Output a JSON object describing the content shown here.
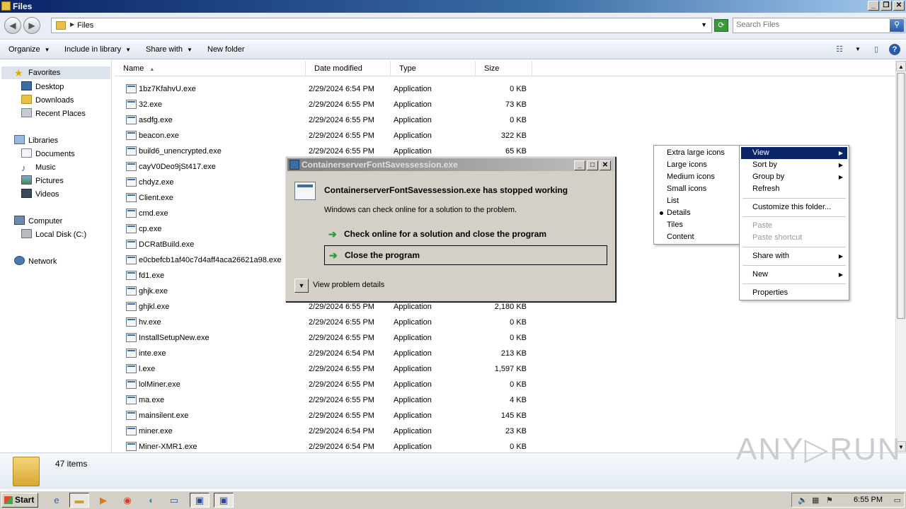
{
  "window": {
    "title": "Files",
    "controls": [
      "_",
      "❐",
      "✕"
    ]
  },
  "address": {
    "path": "Files",
    "search_placeholder": "Search Files"
  },
  "toolbar": {
    "organize": "Organize",
    "include_in_library": "Include in library",
    "share_with": "Share with",
    "new_folder": "New folder"
  },
  "nav": {
    "favorites": "Favorites",
    "desktop": "Desktop",
    "downloads": "Downloads",
    "recent_places": "Recent Places",
    "libraries": "Libraries",
    "documents": "Documents",
    "music": "Music",
    "pictures": "Pictures",
    "videos": "Videos",
    "computer": "Computer",
    "local_disk": "Local Disk (C:)",
    "network": "Network"
  },
  "columns": {
    "name": "Name",
    "date_modified": "Date modified",
    "type": "Type",
    "size": "Size"
  },
  "files": [
    {
      "name": "1bz7KfahvU.exe",
      "date": "2/29/2024 6:54 PM",
      "type": "Application",
      "size": "0 KB"
    },
    {
      "name": "32.exe",
      "date": "2/29/2024 6:55 PM",
      "type": "Application",
      "size": "73 KB"
    },
    {
      "name": "asdfg.exe",
      "date": "2/29/2024 6:55 PM",
      "type": "Application",
      "size": "0 KB"
    },
    {
      "name": "beacon.exe",
      "date": "2/29/2024 6:55 PM",
      "type": "Application",
      "size": "322 KB"
    },
    {
      "name": "build6_unencrypted.exe",
      "date": "2/29/2024 6:55 PM",
      "type": "Application",
      "size": "65 KB"
    },
    {
      "name": "cayV0Deo9jSt417.exe",
      "date": "",
      "type": "",
      "size": ""
    },
    {
      "name": "chdyz.exe",
      "date": "",
      "type": "",
      "size": ""
    },
    {
      "name": "Client.exe",
      "date": "",
      "type": "",
      "size": ""
    },
    {
      "name": "cmd.exe",
      "date": "",
      "type": "",
      "size": ""
    },
    {
      "name": "cp.exe",
      "date": "",
      "type": "",
      "size": ""
    },
    {
      "name": "DCRatBuild.exe",
      "date": "",
      "type": "",
      "size": ""
    },
    {
      "name": "e0cbefcb1af40c7d4aff4aca26621a98.exe",
      "date": "",
      "type": "",
      "size": ""
    },
    {
      "name": "fd1.exe",
      "date": "",
      "type": "",
      "size": ""
    },
    {
      "name": "ghjk.exe",
      "date": "",
      "type": "",
      "size": ""
    },
    {
      "name": "ghjkl.exe",
      "date": "2/29/2024 6:55 PM",
      "type": "Application",
      "size": "2,180 KB"
    },
    {
      "name": "hv.exe",
      "date": "2/29/2024 6:55 PM",
      "type": "Application",
      "size": "0 KB"
    },
    {
      "name": "InstallSetupNew.exe",
      "date": "2/29/2024 6:55 PM",
      "type": "Application",
      "size": "0 KB"
    },
    {
      "name": "inte.exe",
      "date": "2/29/2024 6:54 PM",
      "type": "Application",
      "size": "213 KB"
    },
    {
      "name": "l.exe",
      "date": "2/29/2024 6:55 PM",
      "type": "Application",
      "size": "1,597 KB"
    },
    {
      "name": "lolMiner.exe",
      "date": "2/29/2024 6:55 PM",
      "type": "Application",
      "size": "0 KB"
    },
    {
      "name": "ma.exe",
      "date": "2/29/2024 6:55 PM",
      "type": "Application",
      "size": "4 KB"
    },
    {
      "name": "mainsilent.exe",
      "date": "2/29/2024 6:55 PM",
      "type": "Application",
      "size": "145 KB"
    },
    {
      "name": "miner.exe",
      "date": "2/29/2024 6:54 PM",
      "type": "Application",
      "size": "23 KB"
    },
    {
      "name": "Miner-XMR1.exe",
      "date": "2/29/2024 6:54 PM",
      "type": "Application",
      "size": "0 KB"
    }
  ],
  "status": {
    "count": "47 items"
  },
  "watermark": "ANY▷RUN",
  "dialog": {
    "title": "ContainerserverFontSavessession.exe",
    "heading": "ContainerserverFontSavessession.exe has stopped working",
    "subtext": "Windows can check online for a solution to the problem.",
    "option1": "Check online for a solution and close the program",
    "option2": "Close the program",
    "details": "View problem details"
  },
  "context_menu": {
    "view": "View",
    "sort_by": "Sort by",
    "group_by": "Group by",
    "refresh": "Refresh",
    "customize": "Customize this folder...",
    "paste": "Paste",
    "paste_shortcut": "Paste shortcut",
    "share_with": "Share with",
    "new": "New",
    "properties": "Properties"
  },
  "view_submenu": {
    "extra_large": "Extra large icons",
    "large": "Large icons",
    "medium": "Medium icons",
    "small": "Small icons",
    "list": "List",
    "details": "Details",
    "tiles": "Tiles",
    "content": "Content",
    "selected": "Details"
  },
  "taskbar": {
    "start": "Start",
    "clock": "6:55 PM"
  }
}
